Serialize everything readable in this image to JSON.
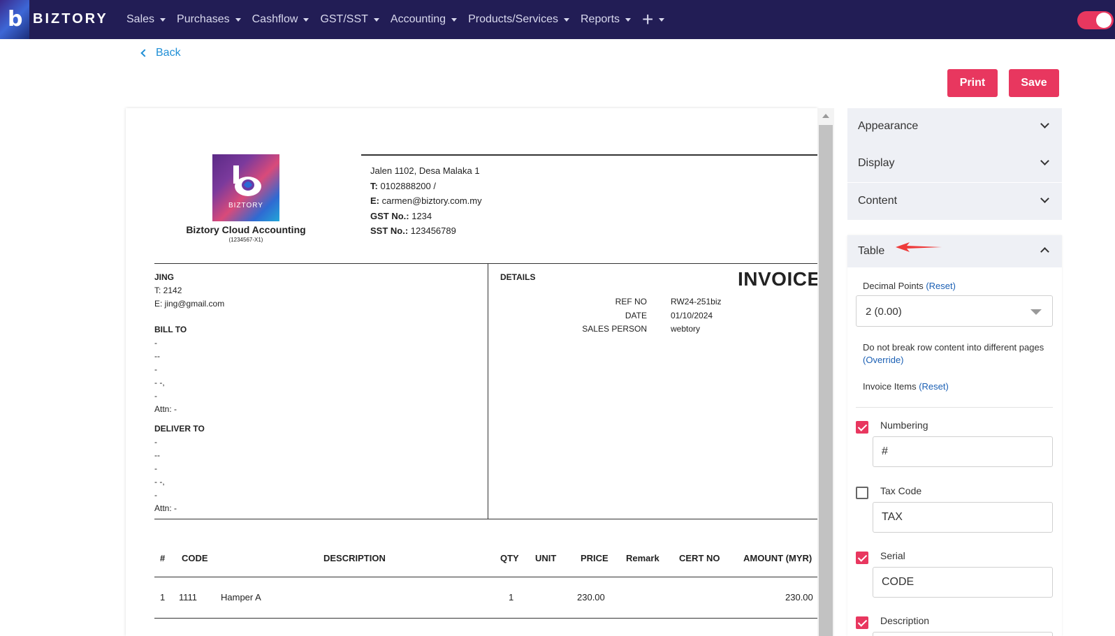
{
  "nav": {
    "brand": "BIZTORY",
    "items": [
      {
        "label": "Sales"
      },
      {
        "label": "Purchases"
      },
      {
        "label": "Cashflow"
      },
      {
        "label": "GST/SST"
      },
      {
        "label": "Accounting"
      },
      {
        "label": "Products/Services"
      },
      {
        "label": "Reports"
      }
    ],
    "plus": "+"
  },
  "actions": {
    "back": "Back",
    "print": "Print",
    "save": "Save"
  },
  "company": {
    "logo_text": "BIZTORY",
    "name": "Biztory Cloud Accounting",
    "reg": "(1234567-X1)",
    "address": "Jalen 1102, Desa Malaka 1",
    "phone_label": "T:",
    "phone": " 0102888200 /",
    "email_label": "E:",
    "email": " carmen@biztory.com.my",
    "gst_label": "GST No.:",
    "gst": " 1234",
    "sst_label": "SST No.:",
    "sst": " 123456789"
  },
  "customer": {
    "name": "JING",
    "phone": "T: 2142",
    "email": "E: jing@gmail.com",
    "bill_to_label": "BILL TO",
    "bill_lines": [
      "-",
      "--",
      "-",
      "- -,",
      "-",
      "Attn: -"
    ],
    "deliver_to_label": "DELIVER TO",
    "deliver_lines": [
      "-",
      "--",
      "-",
      "- -,",
      "-",
      "Attn: -"
    ]
  },
  "details": {
    "label": "DETAILS",
    "title": "INVOICE",
    "ref_no_label": "REF NO",
    "ref_no": "RW24-251biz",
    "date_label": "DATE",
    "date": "01/10/2024",
    "sales_person_label": "SALES PERSON",
    "sales_person": "webtory"
  },
  "table": {
    "headers": {
      "num": "#",
      "code": "CODE",
      "description": "DESCRIPTION",
      "qty": "QTY",
      "unit": "UNIT",
      "price": "PRICE",
      "remark": "Remark",
      "cert": "CERT NO",
      "amount": "AMOUNT (MYR)"
    },
    "rows": [
      {
        "num": "1",
        "code": "1111",
        "description": "Hamper A",
        "qty": "1",
        "unit": "",
        "price": "230.00",
        "remark": "",
        "cert": "",
        "amount": "230.00"
      }
    ]
  },
  "panel": {
    "appearance": "Appearance",
    "display": "Display",
    "content": "Content",
    "table": "Table",
    "decimal_label": "Decimal Points",
    "reset": "(Reset)",
    "decimal_value": "2 (0.00)",
    "no_break_text": "Do not break row content into different pages",
    "override": "(Override)",
    "invoice_items": "Invoice Items",
    "fields": [
      {
        "label": "Numbering",
        "checked": true,
        "value": "#"
      },
      {
        "label": "Tax Code",
        "checked": false,
        "value": "TAX"
      },
      {
        "label": "Serial",
        "checked": true,
        "value": "CODE"
      },
      {
        "label": "Description",
        "checked": true,
        "value": ""
      }
    ]
  },
  "colors": {
    "accent": "#e8375f",
    "nav_bg": "#221d55",
    "link": "#1f8fd6"
  }
}
